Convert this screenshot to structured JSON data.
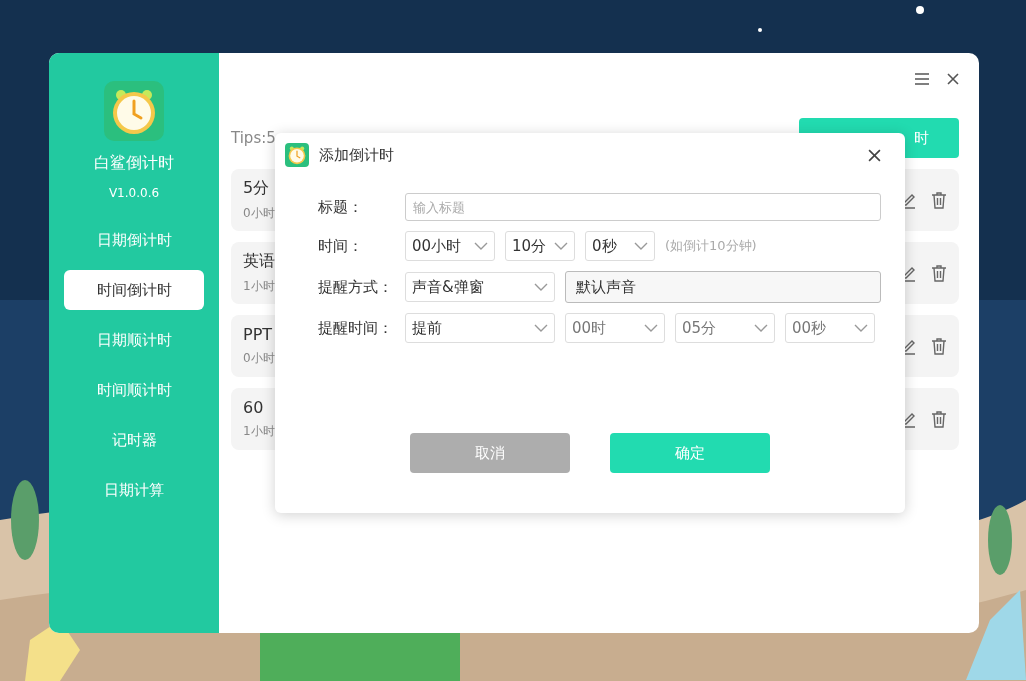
{
  "app": {
    "name": "白鲨倒计时",
    "version": "V1.0.0.6"
  },
  "sidebar": {
    "items": [
      {
        "label": "日期倒计时",
        "selected": false
      },
      {
        "label": "时间倒计时",
        "selected": true
      },
      {
        "label": "日期顺计时",
        "selected": false
      },
      {
        "label": "时间顺计时",
        "selected": false
      },
      {
        "label": "记时器",
        "selected": false
      },
      {
        "label": "日期计算",
        "selected": false
      }
    ]
  },
  "tips": "Tips:5",
  "add_button": {
    "label": "时"
  },
  "timers": [
    {
      "title": "5分",
      "subtitle": "0小时"
    },
    {
      "title": "英语",
      "subtitle": "1小时"
    },
    {
      "title": "PPT",
      "subtitle": "0小时"
    },
    {
      "title": "60",
      "subtitle": "1小时"
    }
  ],
  "dialog": {
    "title": "添加倒计时",
    "title_field": {
      "label": "标题：",
      "placeholder": "输入标题"
    },
    "time_row": {
      "label": "时间：",
      "selects": [
        "00小时",
        "10分",
        "0秒"
      ],
      "hint": "(如倒计10分钟)"
    },
    "remind_mode": {
      "label": "提醒方式：",
      "select": "声音&弹窗",
      "sound": "默认声音"
    },
    "remind_time": {
      "label": "提醒时间：",
      "select": "提前",
      "selects": [
        "00时",
        "05分",
        "00秒"
      ]
    },
    "cancel": "取消",
    "confirm": "确定"
  }
}
